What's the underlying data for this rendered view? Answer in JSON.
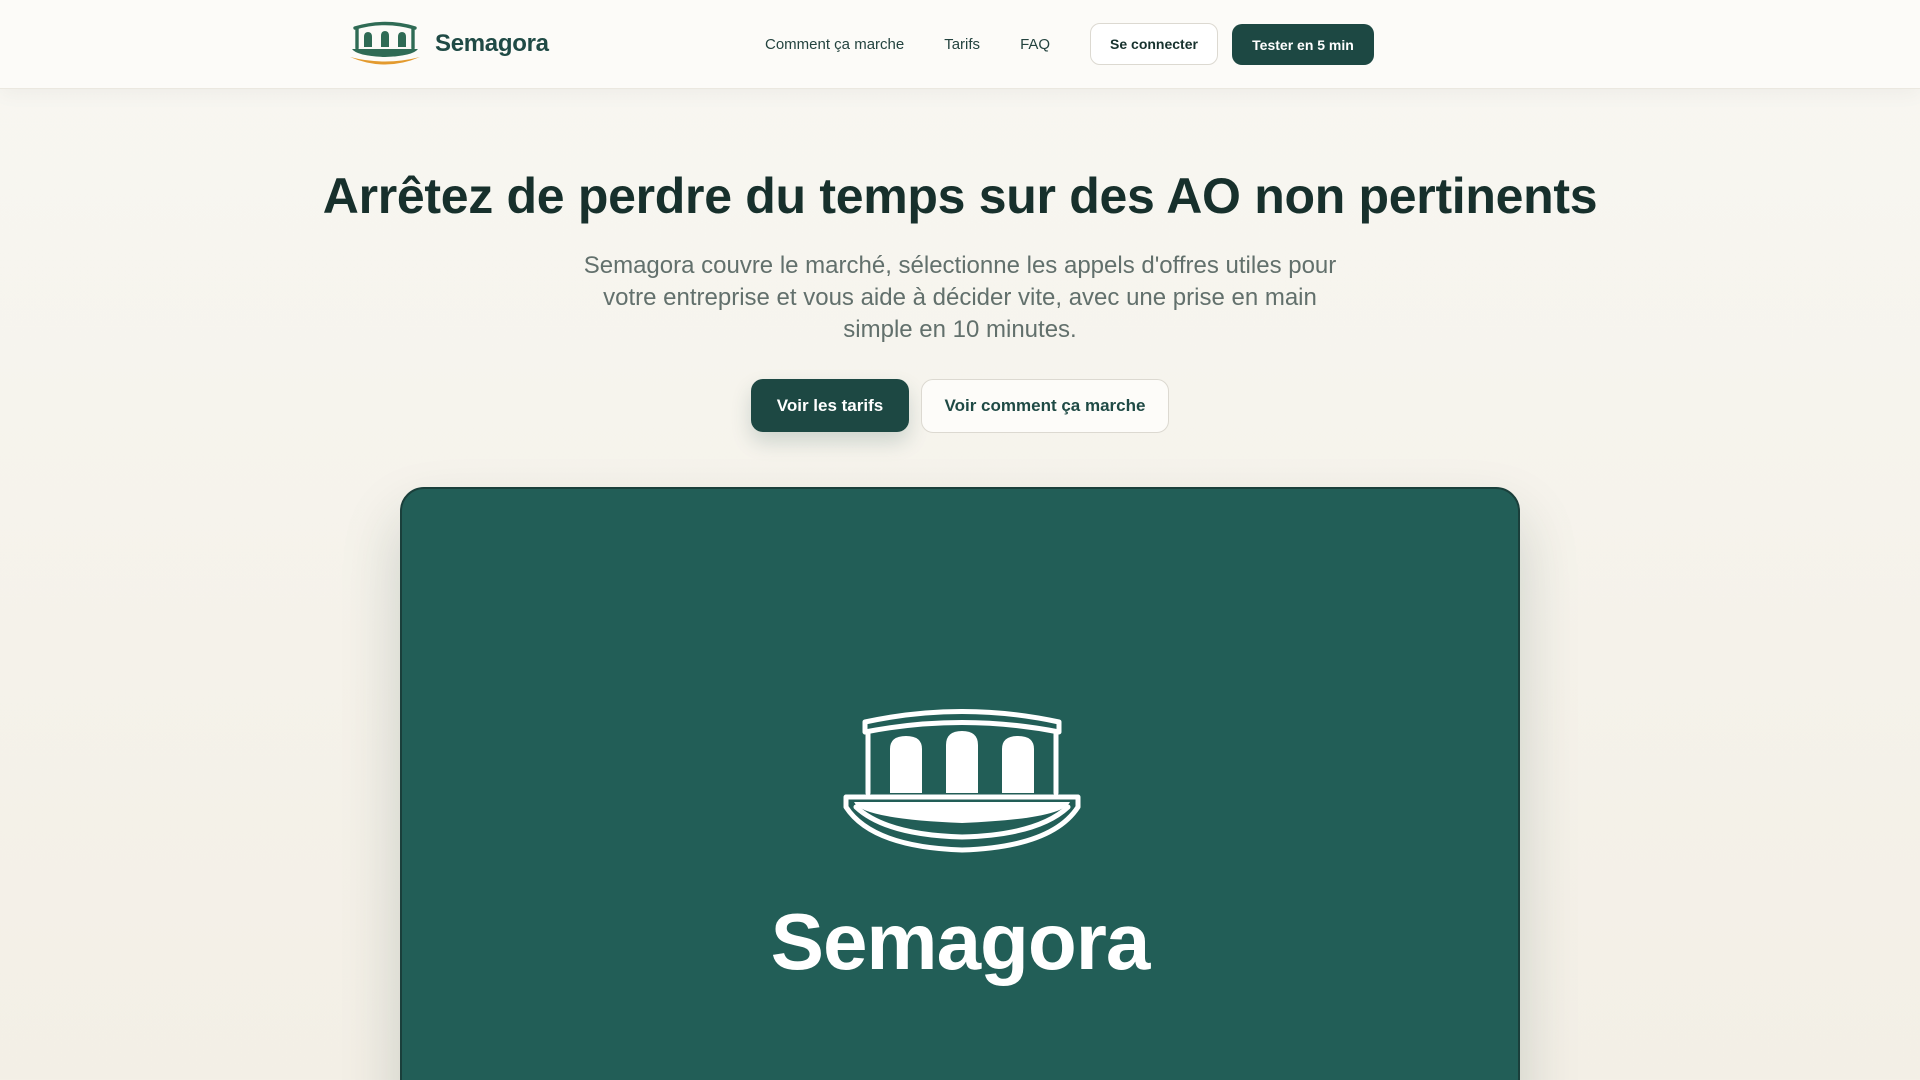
{
  "header": {
    "brand_name": "Semagora",
    "nav": {
      "how_it_works": "Comment ça marche",
      "pricing": "Tarifs",
      "faq": "FAQ"
    },
    "login_label": "Se connecter",
    "try_label": "Tester en 5 min"
  },
  "hero": {
    "title": "Arrêtez de perdre du temps sur des AO non pertinents",
    "subtitle": "Semagora couvre le marché, sélectionne les appels d'offres utiles pour votre entreprise et vous aide à décider vite, avec une prise en main simple en 10 minutes.",
    "primary_cta": "Voir les tarifs",
    "secondary_cta": "Voir comment ça marche"
  },
  "showcase": {
    "brand_name": "Semagora",
    "logo_icon": "semagora-arch-icon"
  },
  "colors": {
    "brand_dark": "#1d4843",
    "showcase_bg": "#225e57",
    "logo_green": "#2f6b55",
    "logo_orange": "#e39a2e",
    "text_dark": "#17302c",
    "text_muted": "#62706c"
  }
}
